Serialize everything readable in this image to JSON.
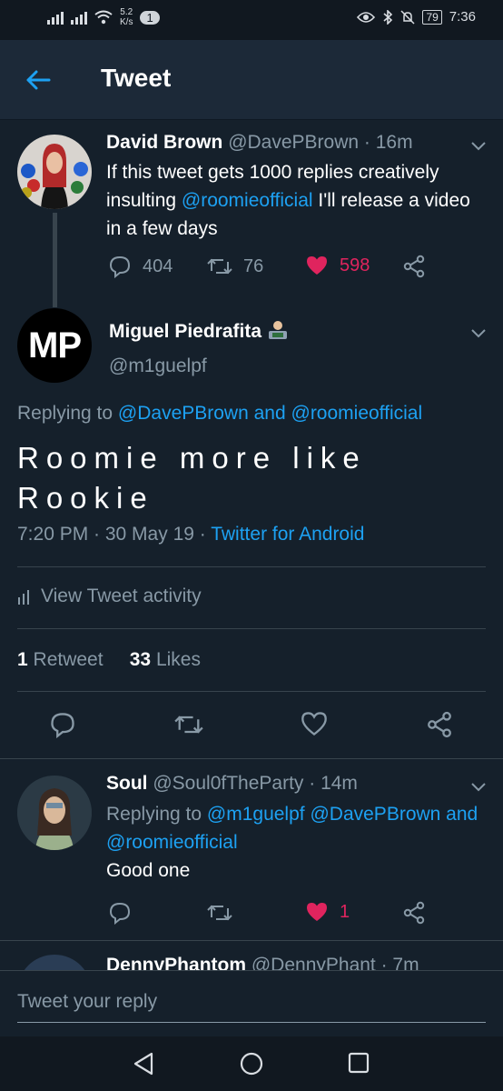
{
  "status_bar": {
    "speed_value": "5.2",
    "speed_unit": "K/s",
    "notification_count": "1",
    "battery": "79",
    "time": "7:36"
  },
  "header": {
    "title": "Tweet"
  },
  "parent_tweet": {
    "name": "David Brown",
    "handle": "@DavePBrown",
    "time": "· 16m",
    "text_before": "If this tweet gets 1000 replies creatively insulting ",
    "mention": "@roomieofficial",
    "text_after": " I'll release a video in a few days",
    "replies": "404",
    "retweets": "76",
    "likes": "598"
  },
  "main_tweet": {
    "avatar_initials": "MP",
    "name": "Miguel Piedrafita",
    "handle": "@m1guelpf",
    "replying_prefix": "Replying to ",
    "replying_mention_1": "@DavePBrown",
    "replying_and": " and ",
    "replying_mention_2": "@roomieofficial",
    "text": "Roomie more like Rookie",
    "time": "7:20 PM · 30 May 19 · ",
    "source": "Twitter for Android",
    "activity_label": "View Tweet activity",
    "retweet_count": "1",
    "retweet_label": " Retweet",
    "like_count": "33",
    "like_label": " Likes"
  },
  "reply_tweet": {
    "name": "Soul",
    "handle": "@Soul0fTheParty",
    "time": "· 14m",
    "replying_prefix": "Replying to ",
    "mention_1": "@m1guelpf",
    "mention_2": "@DavePBrown",
    "and": " and ",
    "mention_3": "@roomieofficial",
    "text": "Good one",
    "likes": "1"
  },
  "next_tweet": {
    "name": "DennyPhantom",
    "handle": "@DennyPhant",
    "time": "· 7m"
  },
  "reply_bar": {
    "placeholder": "Tweet your reply"
  },
  "colors": {
    "background": "#15202b",
    "accent": "#1da1f2",
    "like": "#e0245e",
    "muted": "#8899a6"
  },
  "icons": [
    "back-arrow-icon",
    "chevron-down-icon",
    "reply-icon",
    "retweet-icon",
    "heart-icon",
    "share-icon",
    "activity-bars-icon",
    "back-nav-icon",
    "home-nav-icon",
    "recents-nav-icon"
  ]
}
